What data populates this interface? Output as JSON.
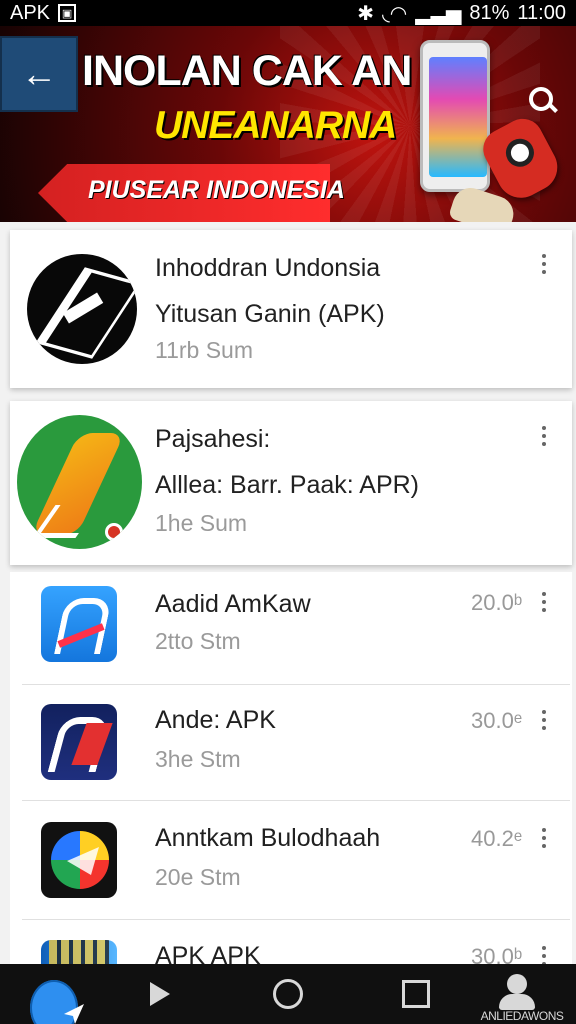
{
  "status": {
    "left": "APK",
    "battery": "81%",
    "time": "11:00"
  },
  "header": {
    "title": "INOLAN CAK AN",
    "subtitle": "UNEANARNA",
    "promo": "PIUSEAR INDONESIA"
  },
  "cards": [
    {
      "title": "Inhoddran Undonsia",
      "subtitle": "Yitusan Ganin (APK)",
      "meta": "11rb Sum"
    },
    {
      "title": "Pajsahesi:",
      "subtitle": "Alllea: Barr. Paak: APR)",
      "meta": "1he Sum"
    }
  ],
  "list": [
    {
      "title": "Aadid AmKaw",
      "meta": "2tto Stm",
      "price": "20.0ᵇ"
    },
    {
      "title": "Ande: APK",
      "meta": "3he Stm",
      "price": "30.0ᵉ"
    },
    {
      "title": "Anntkam Bulodhaah",
      "meta": "20e Stm",
      "price": "40.2ᵉ"
    },
    {
      "title": "APK APK",
      "price": "30.0ᵇ"
    }
  ],
  "bottom_nav": {
    "profile_label": "ANLIEDAWONS"
  },
  "colors": {
    "status_bar": "#000000",
    "banner_dark": "#170303",
    "banner_red": "#c0140f",
    "accent_yellow": "#ffe600",
    "accent_blue": "#2e8ff0"
  }
}
